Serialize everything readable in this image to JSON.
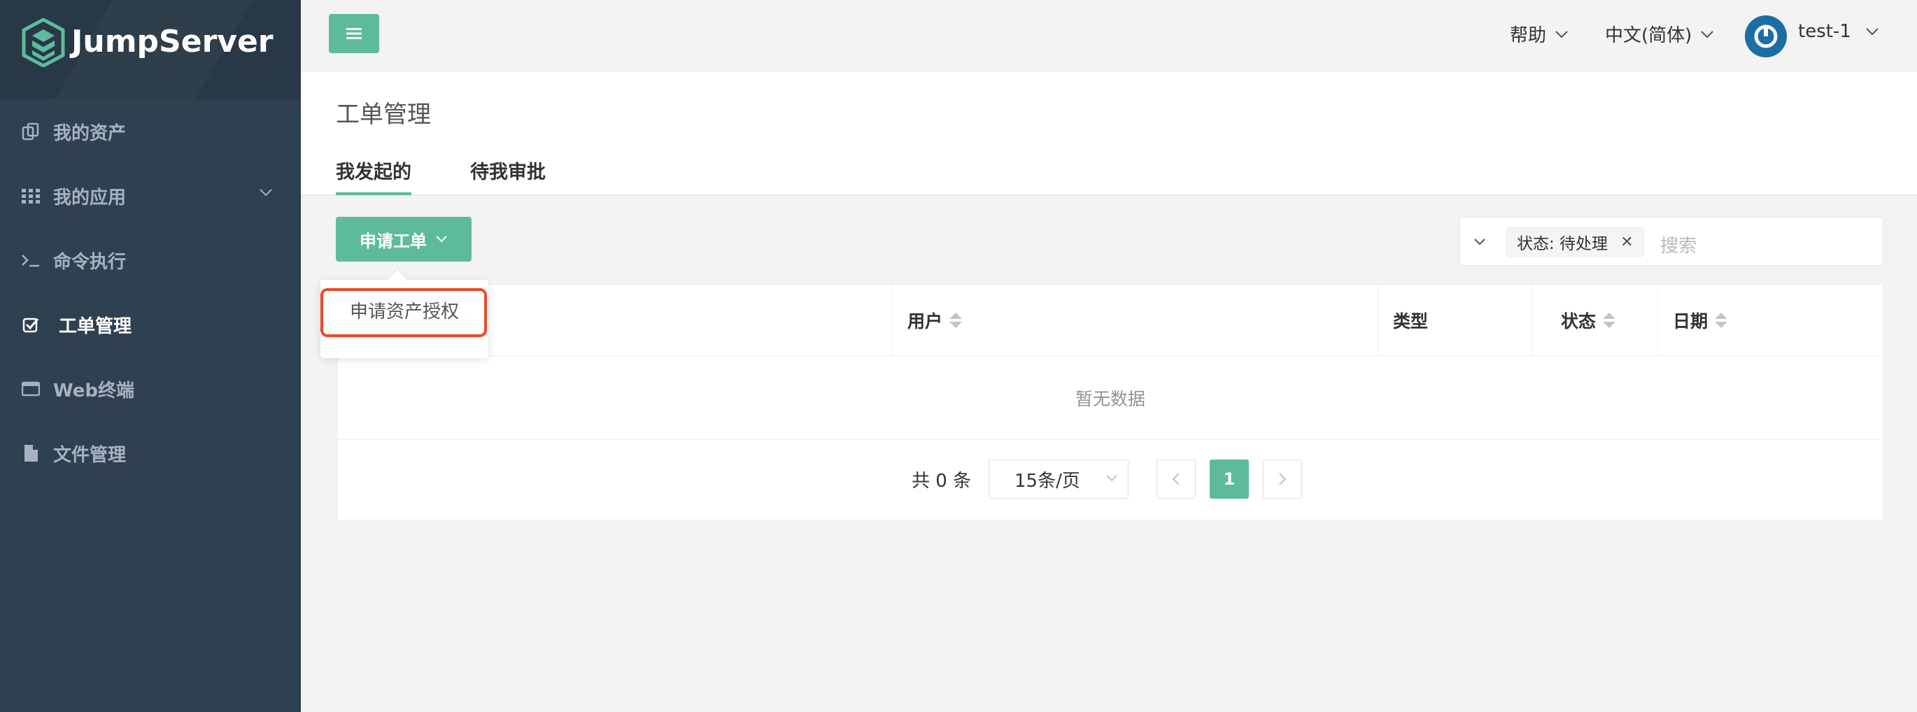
{
  "app": {
    "logo_text": "JumpServer"
  },
  "sidebar": {
    "items": [
      {
        "label": "我的资产",
        "icon": "copy-icon"
      },
      {
        "label": "我的应用",
        "icon": "grid-icon",
        "has_submenu": true
      },
      {
        "label": "命令执行",
        "icon": "terminal-icon"
      },
      {
        "label": "工单管理",
        "icon": "check-square-icon",
        "active": true
      },
      {
        "label": "Web终端",
        "icon": "window-icon"
      },
      {
        "label": "文件管理",
        "icon": "file-icon"
      }
    ]
  },
  "topbar": {
    "help": "帮助",
    "language": "中文(简体)",
    "user": "test-1"
  },
  "page": {
    "title": "工单管理",
    "tabs": [
      {
        "label": "我发起的",
        "active": true
      },
      {
        "label": "待我审批",
        "active": false
      }
    ]
  },
  "toolbar": {
    "apply_button": "申请工单",
    "dropdown_items": [
      "申请资产授权"
    ]
  },
  "search": {
    "filter_tag": "状态: 待处理",
    "placeholder": "搜索"
  },
  "table": {
    "columns": [
      "用户",
      "类型",
      "状态",
      "日期"
    ],
    "empty_text": "暂无数据"
  },
  "pagination": {
    "total": "共 0 条",
    "page_size": "15条/页",
    "current_page": "1"
  },
  "colors": {
    "sidebar_bg": "#2f4050",
    "accent": "#5dbb9b",
    "highlight_border": "#e84c2b"
  }
}
